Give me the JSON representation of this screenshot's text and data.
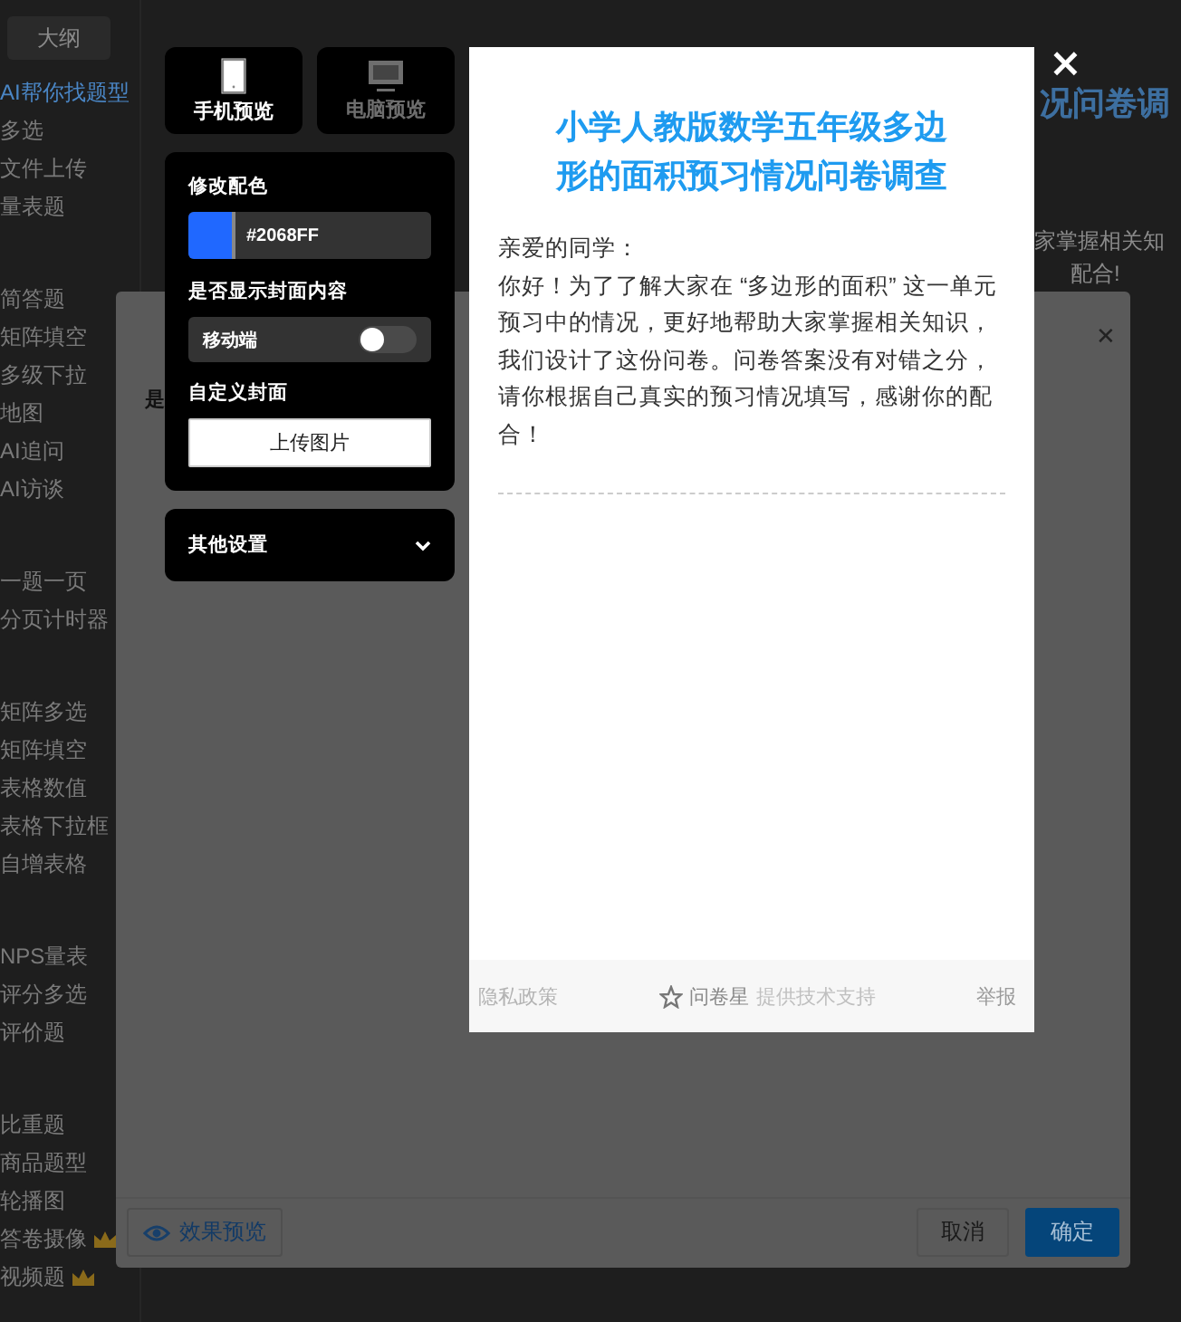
{
  "sidebar": {
    "outline_button": "大纲",
    "groups": [
      [
        {
          "label": "AI帮你找题型",
          "kind": "highlight"
        },
        {
          "label": "多选",
          "kind": "plain"
        },
        {
          "label": "文件上传",
          "kind": "plain"
        },
        {
          "label": "量表题",
          "kind": "plain"
        }
      ],
      [
        {
          "label": "简答题",
          "kind": "plain"
        },
        {
          "label": "矩阵填空",
          "kind": "plain"
        },
        {
          "label": "多级下拉",
          "kind": "plain"
        },
        {
          "label": "地图",
          "kind": "plain"
        },
        {
          "label": "AI追问",
          "kind": "plain"
        },
        {
          "label": "AI访谈",
          "kind": "plain"
        }
      ],
      [
        {
          "label": "一题一页",
          "kind": "plain"
        },
        {
          "label": "分页计时器",
          "kind": "plain"
        }
      ],
      [
        {
          "label": "矩阵多选",
          "kind": "plain"
        },
        {
          "label": "矩阵填空",
          "kind": "plain"
        },
        {
          "label": "表格数值",
          "kind": "plain"
        },
        {
          "label": "表格下拉框",
          "kind": "plain"
        },
        {
          "label": "自增表格",
          "kind": "plain"
        }
      ],
      [
        {
          "label": "NPS量表",
          "kind": "plain"
        },
        {
          "label": "评分多选",
          "kind": "plain"
        },
        {
          "label": "评价题",
          "kind": "plain"
        }
      ],
      [
        {
          "label": "比重题",
          "kind": "plain"
        },
        {
          "label": "商品题型",
          "kind": "plain"
        },
        {
          "label": "轮播图",
          "kind": "plain"
        },
        {
          "label": "答卷摄像",
          "kind": "premium"
        },
        {
          "label": "视频题",
          "kind": "premium"
        }
      ]
    ]
  },
  "background_page": {
    "title_fragment": "况问卷调",
    "text_fragments": [
      "家掌握相关知",
      "配合!"
    ]
  },
  "dialog": {
    "close": "✕",
    "body_fragment": "是",
    "preview_button": "效果预览",
    "cancel_button": "取消",
    "ok_button": "确定"
  },
  "preview": {
    "modes": [
      {
        "label": "手机预览",
        "selected": true
      },
      {
        "label": "电脑预览",
        "selected": false
      }
    ],
    "settings": {
      "color_label": "修改配色",
      "color": "#2068FF",
      "color_value": "#2068FF",
      "cover_label": "是否显示封面内容",
      "cover_toggle": {
        "label": "移动端",
        "on": false
      },
      "custom_cover_label": "自定义封面",
      "upload_button": "上传图片"
    },
    "other_settings": {
      "label": "其他设置",
      "expanded": false
    },
    "card": {
      "title": "小学人教版数学五年级多边形的面积预习情况问卷调查",
      "paragraphs": [
        "亲爱的同学：",
        "你好！为了了解大家在 “多边形的面积” 这一单元预习中的情况，更好地帮助大家掌握相关知识，我们设计了这份问卷。问卷答案没有对错之分，请你根据自己真实的预习情况填写，感谢你的配合！"
      ],
      "footer": {
        "privacy": "隐私政策",
        "brand": "问卷星",
        "support": "提供技术支持",
        "report": "举报"
      }
    },
    "close": "×"
  }
}
